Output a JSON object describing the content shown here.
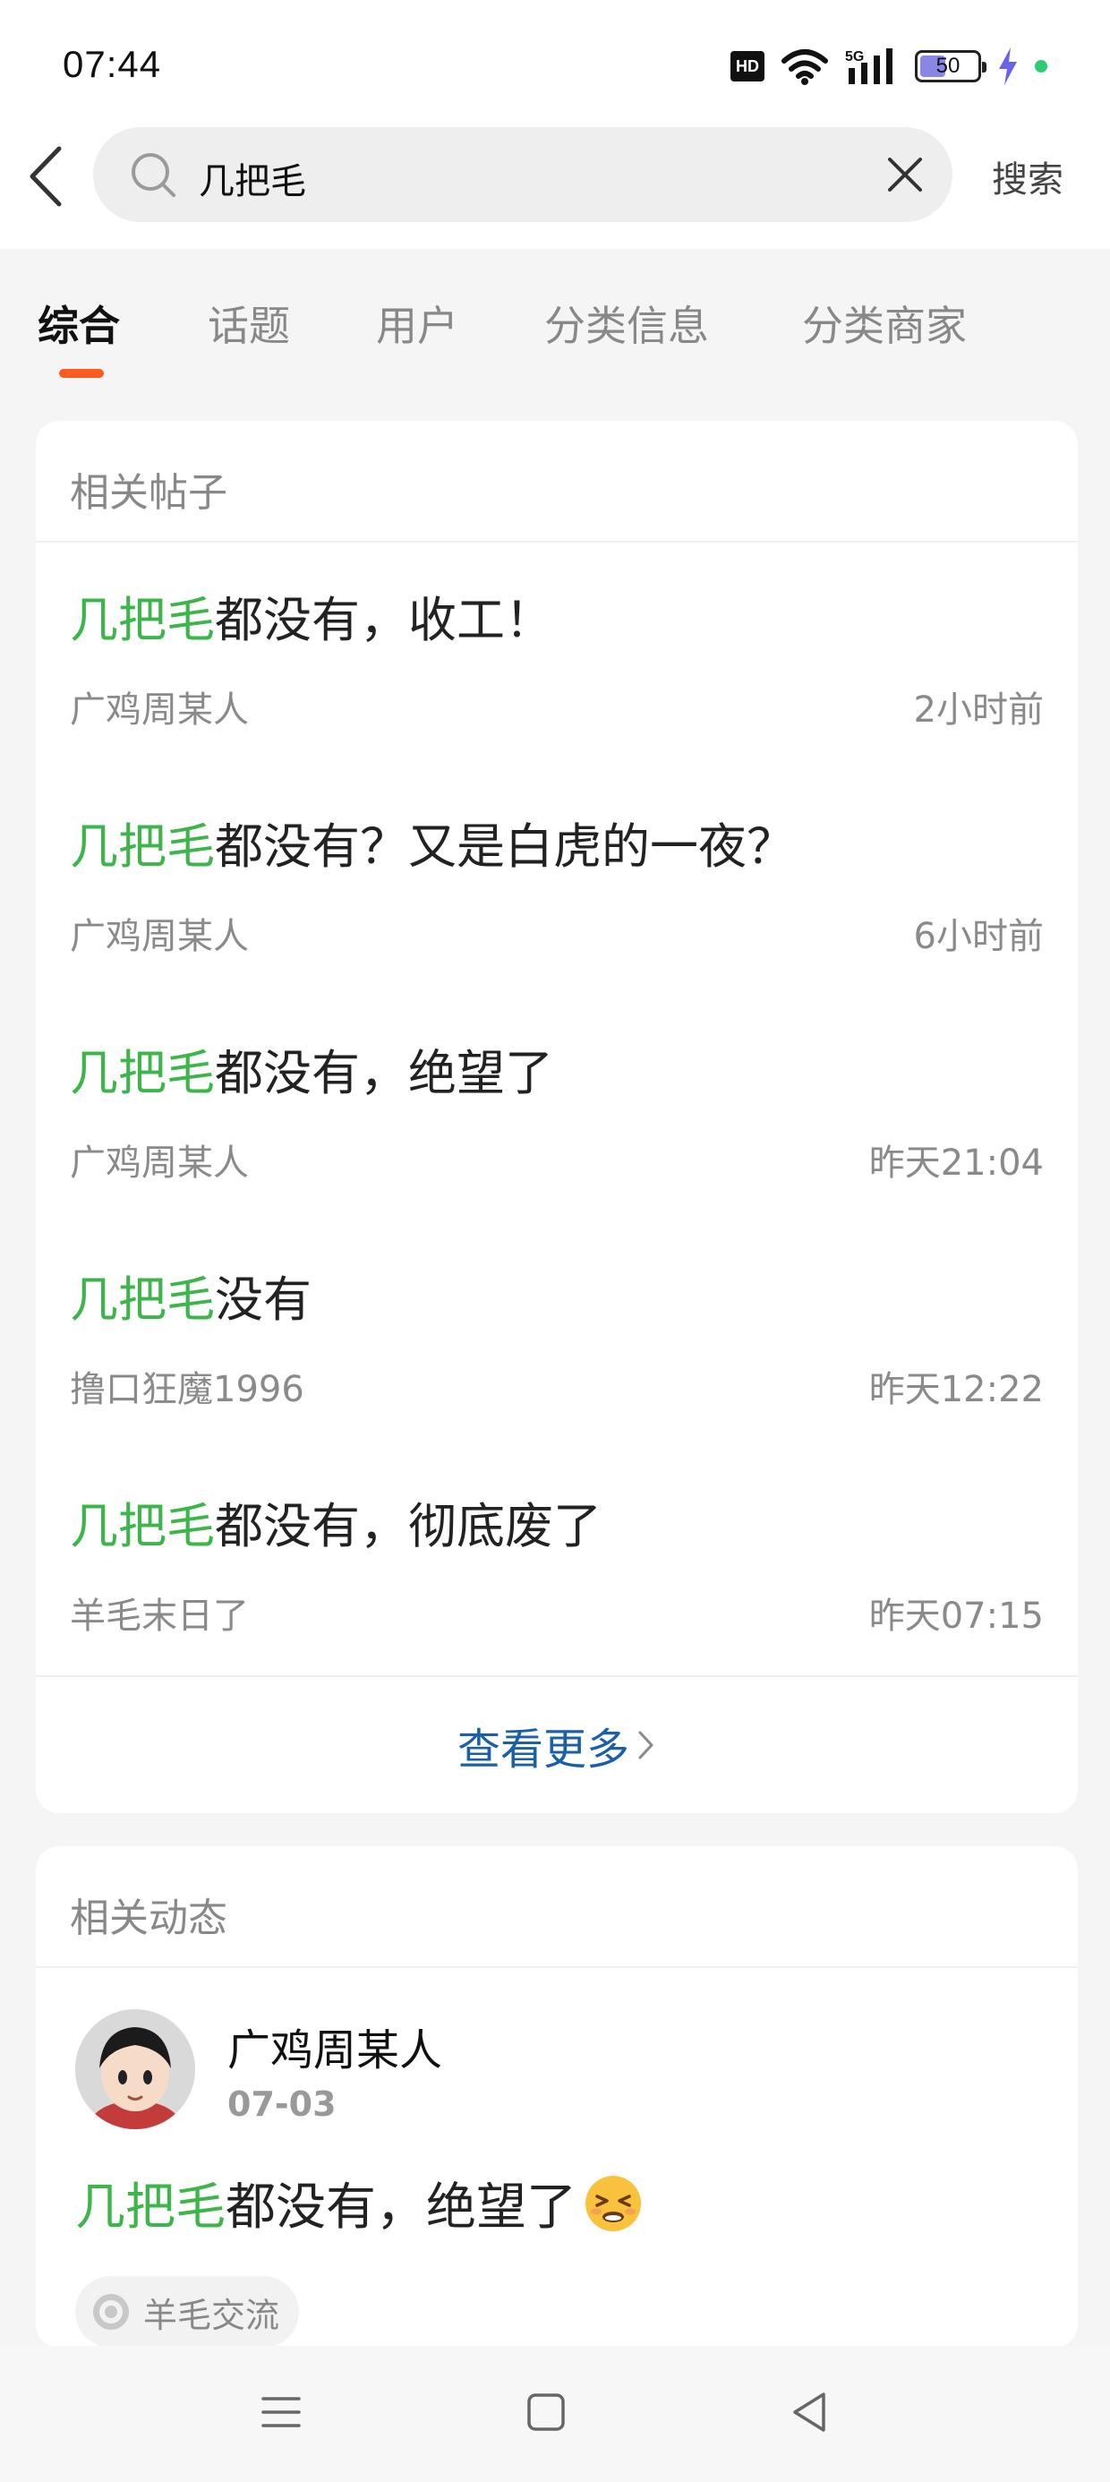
{
  "status_bar": {
    "time": "07:44",
    "hd_label": "HD",
    "network_label": "5G",
    "battery_level": "50",
    "battery_fraction": 0.5
  },
  "search": {
    "query": "几把毛",
    "button_label": "搜索"
  },
  "tabs": [
    {
      "label": "综合",
      "active": true
    },
    {
      "label": "话题",
      "active": false
    },
    {
      "label": "用户",
      "active": false
    },
    {
      "label": "分类信息",
      "active": false
    },
    {
      "label": "分类商家",
      "active": false
    }
  ],
  "related_posts": {
    "header": "相关帖子",
    "posts": [
      {
        "keyword": "几把毛",
        "rest": "都没有，收工！",
        "author": "广鸡周某人",
        "time": "2小时前"
      },
      {
        "keyword": "几把毛",
        "rest": "都没有？又是白虎的一夜？",
        "author": "广鸡周某人",
        "time": "6小时前"
      },
      {
        "keyword": "几把毛",
        "rest": "都没有，绝望了",
        "author": "广鸡周某人",
        "time": "昨天21:04"
      },
      {
        "keyword": "几把毛",
        "rest": "没有",
        "author": "撸口狂魔1996",
        "time": "昨天12:22"
      },
      {
        "keyword": "几把毛",
        "rest": "都没有，彻底废了",
        "author": "羊毛末日了",
        "time": "昨天07:15"
      }
    ],
    "see_more": "查看更多"
  },
  "related_dynamics": {
    "header": "相关动态",
    "item": {
      "user": "广鸡周某人",
      "date": "07-03",
      "keyword": "几把毛",
      "rest": "都没有，绝望了",
      "emoji": "persevering-face-icon",
      "topic": "羊毛交流"
    }
  },
  "colors": {
    "keyword_green": "#3cb54a",
    "tab_indicator": "#ff5a1f",
    "link_blue": "#1a5fa8"
  }
}
